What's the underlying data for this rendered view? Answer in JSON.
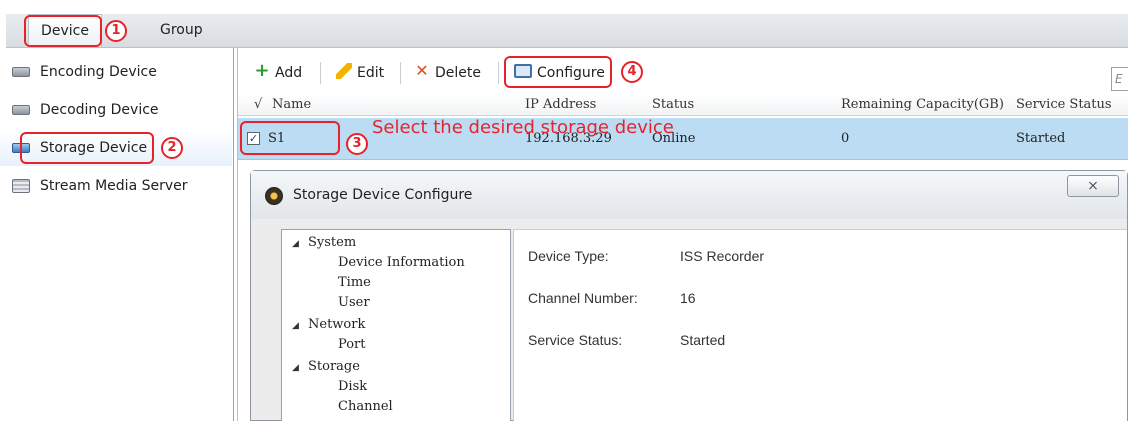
{
  "top_tabs": {
    "device": "Device",
    "group": "Group"
  },
  "markers": {
    "m1": "1",
    "m2": "2",
    "m3": "3",
    "m4": "4"
  },
  "sidebar": {
    "items": [
      {
        "label": "Encoding Device",
        "icon": "encoder-device-icon"
      },
      {
        "label": "Decoding Device",
        "icon": "decoder-device-icon"
      },
      {
        "label": "Storage Device",
        "icon": "storage-device-icon"
      },
      {
        "label": "Stream Media Server",
        "icon": "media-server-icon"
      }
    ]
  },
  "toolbar": {
    "add": "Add",
    "edit": "Edit",
    "delete": "Delete",
    "configure": "Configure",
    "filter_placeholder": "E"
  },
  "grid": {
    "columns": [
      "√",
      "Name",
      "IP Address",
      "Status",
      "Remaining Capacity(GB)",
      "Service Status"
    ],
    "rows": [
      {
        "checked": "✓",
        "name": "S1",
        "ip": "192.168.3.29",
        "status": "Online",
        "capacity": "0",
        "service_status": "Started"
      }
    ]
  },
  "callout": "Select the desired storage device",
  "dialog": {
    "title": "Storage Device Configure",
    "close": "⨯",
    "tree": {
      "system": "System",
      "device_information": "Device Information",
      "time": "Time",
      "user": "User",
      "network": "Network",
      "port": "Port",
      "storage": "Storage",
      "disk": "Disk",
      "channel": "Channel"
    },
    "info": {
      "device_type_label": "Device Type:",
      "device_type_value": "ISS Recorder",
      "channel_number_label": "Channel Number:",
      "channel_number_value": "16",
      "service_status_label": "Service Status:",
      "service_status_value": "Started"
    }
  },
  "colors": {
    "annotation_red": "#e8222a",
    "selected_row": "#bcdcf3"
  }
}
